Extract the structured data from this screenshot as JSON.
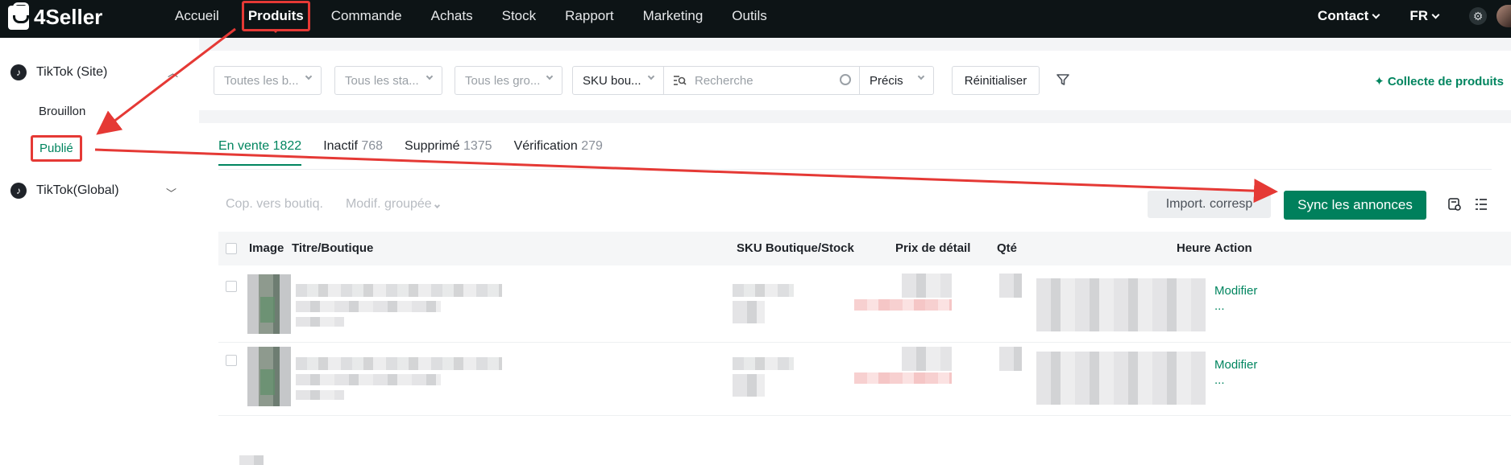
{
  "brand": {
    "name": "4Seller"
  },
  "topnav": {
    "items": [
      "Accueil",
      "Produits",
      "Commande",
      "Achats",
      "Stock",
      "Rapport",
      "Marketing",
      "Outils"
    ],
    "active_index": 1,
    "contact": "Contact",
    "language": "FR"
  },
  "sidebar": {
    "groups": [
      {
        "label": "TikTok (Site)",
        "expanded": true,
        "children": [
          "Brouillon",
          "Publié"
        ],
        "active_child": "Publié"
      },
      {
        "label": "TikTok(Global)",
        "expanded": false
      }
    ]
  },
  "filters": {
    "store_placeholder": "Toutes les b...",
    "status_placeholder": "Tous les sta...",
    "group_placeholder": "Tous les gro...",
    "search_field": "SKU bou...",
    "search_placeholder": "Recherche",
    "match_mode": "Précis",
    "reset": "Réinitialiser",
    "collect": "Collecte de produits"
  },
  "tabs": [
    {
      "label": "En vente",
      "count": "1822",
      "active": true
    },
    {
      "label": "Inactif",
      "count": "768"
    },
    {
      "label": "Supprimé",
      "count": "1375"
    },
    {
      "label": "Vérification",
      "count": "279"
    }
  ],
  "toolbar": {
    "copy_to_store": "Cop. vers boutiq.",
    "bulk_edit": "Modif. groupée",
    "import": "Import. corresp",
    "sync": "Sync les annonces"
  },
  "table": {
    "columns": [
      "Image",
      "Titre/Boutique",
      "SKU Boutique/Stock",
      "Prix de détail",
      "Qté",
      "Heure",
      "Action"
    ],
    "rows": [
      {
        "action_edit": "Modifier",
        "action_more": "..."
      },
      {
        "action_edit": "Modifier",
        "action_more": "..."
      }
    ]
  },
  "colors": {
    "accent": "#00805c",
    "annotation": "#e53935",
    "topbar": "#0d1416"
  }
}
